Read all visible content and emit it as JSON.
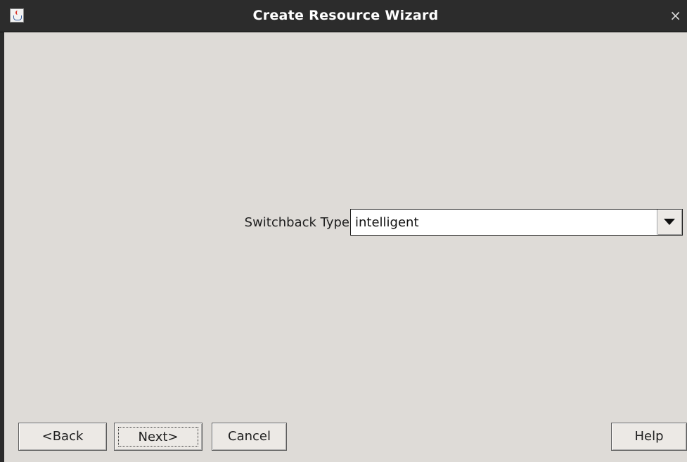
{
  "window": {
    "title": "Create Resource Wizard",
    "app_icon": "java-cup-icon",
    "close_glyph": "×",
    "close_icon": "close-icon"
  },
  "form": {
    "switchback_label": "Switchback Type",
    "switchback_value": "intelligent",
    "dropdown_icon": "chevron-down-icon"
  },
  "buttons": {
    "back_label": "<Back",
    "next_label": "Next>",
    "cancel_label": "Cancel",
    "help_label": "Help"
  }
}
